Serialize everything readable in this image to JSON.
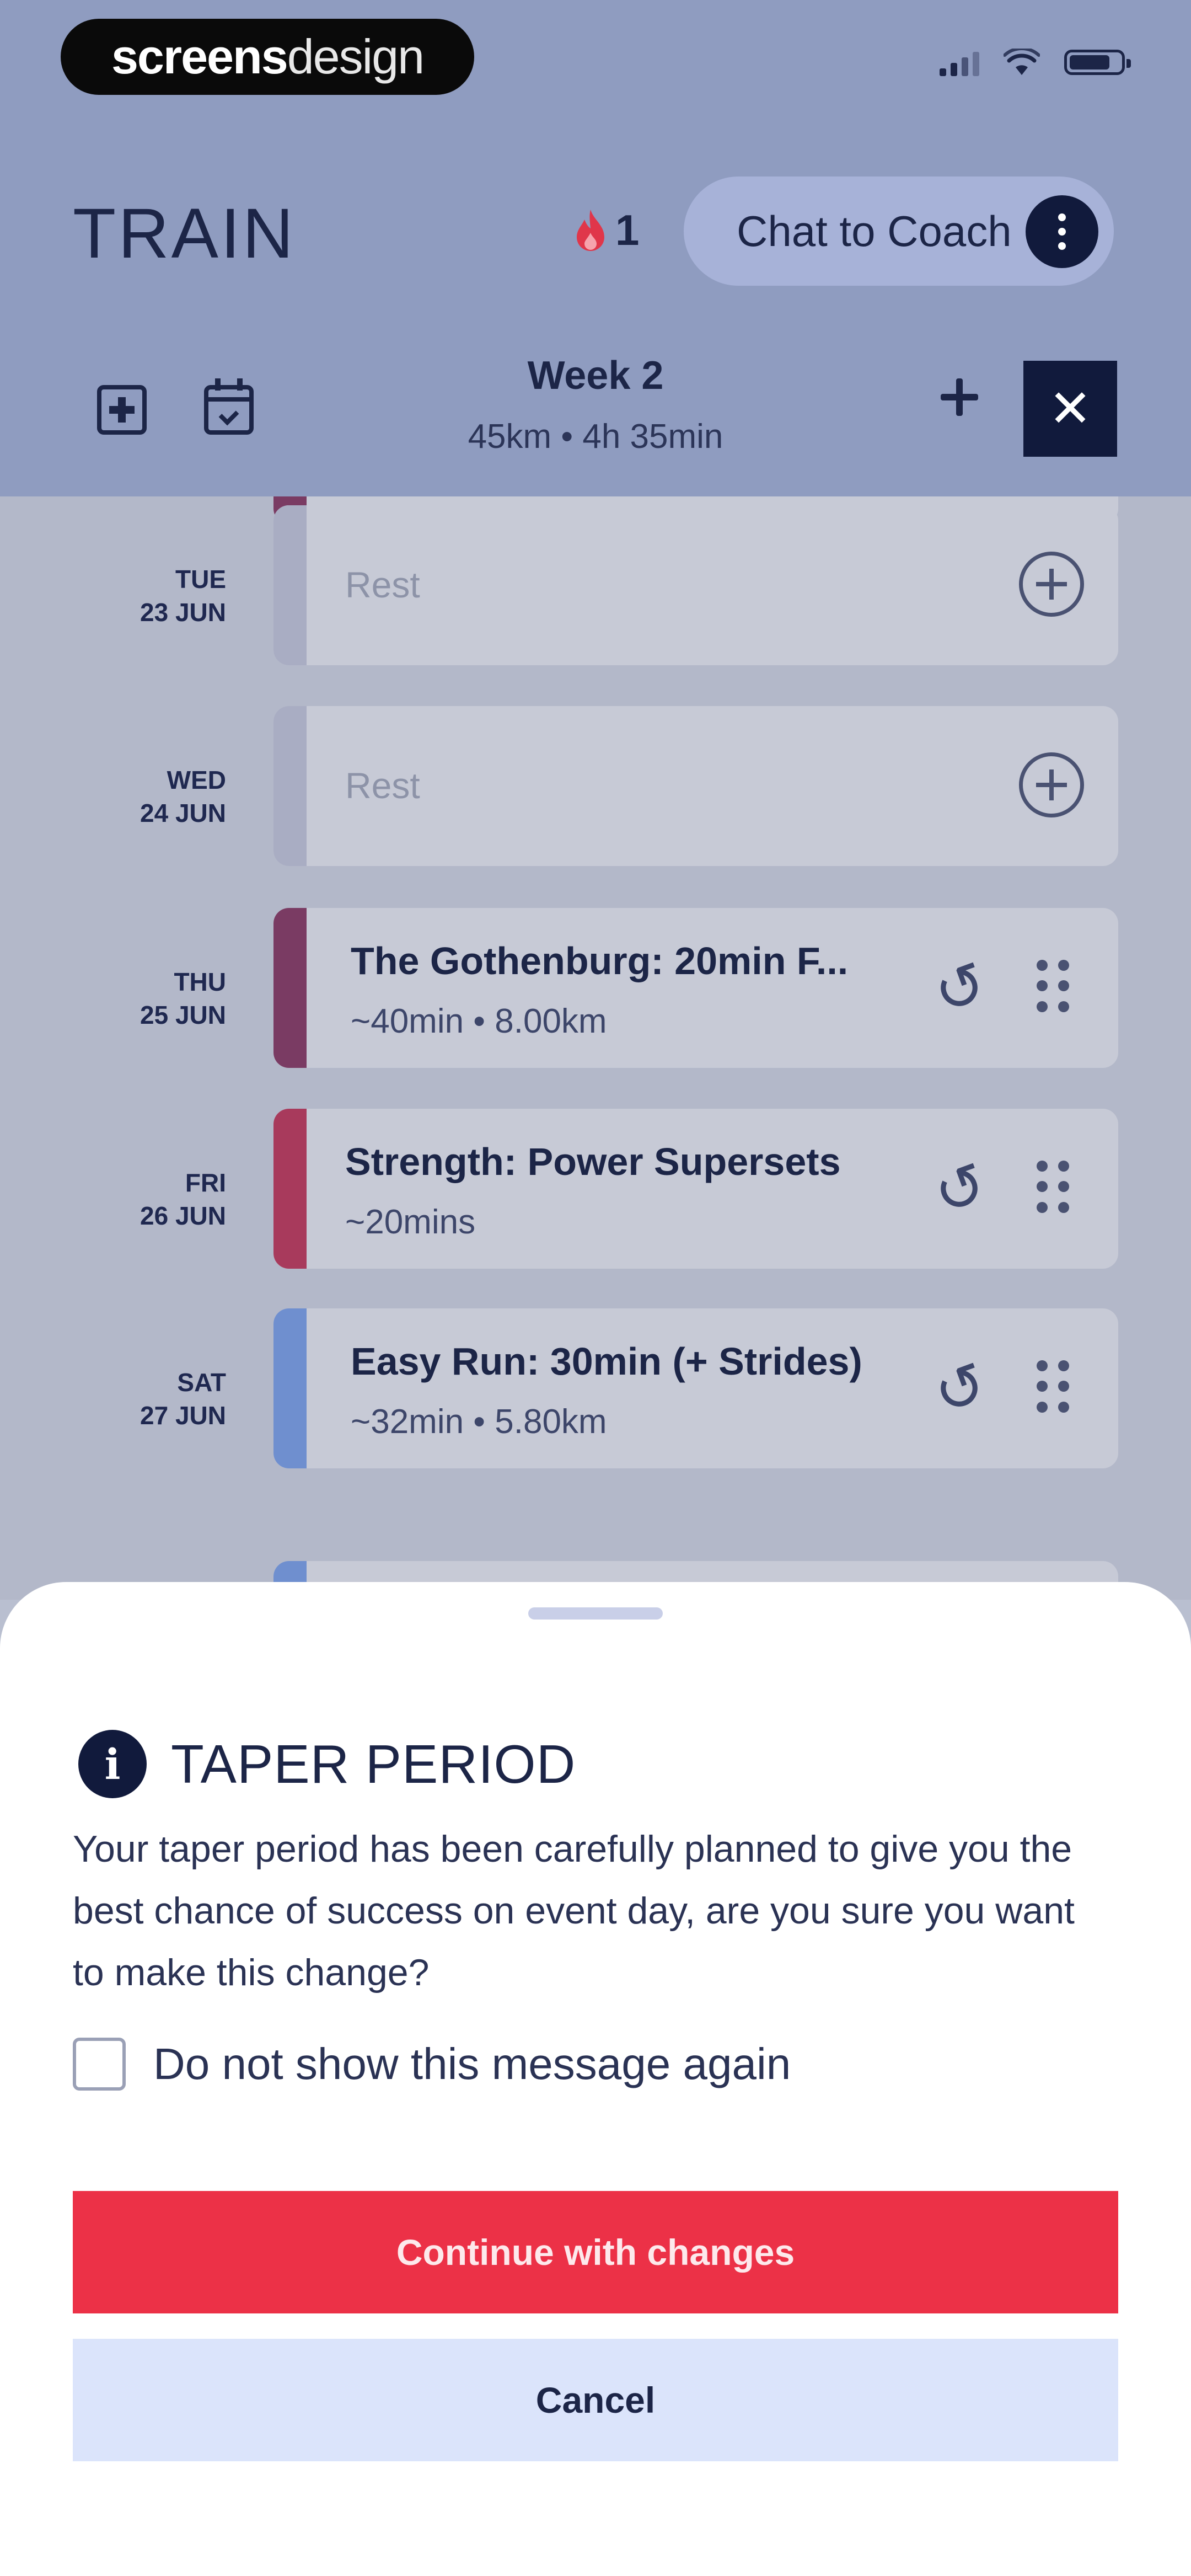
{
  "brand": {
    "part1": "screens",
    "part2": "design"
  },
  "header": {
    "title": "TRAIN",
    "streak_count": "1",
    "coach_button_label": "Chat to Coach"
  },
  "week": {
    "title": "Week 2",
    "summary": "45km • 4h 35min"
  },
  "days": [
    {
      "dow": "TUE",
      "date": "23 JUN",
      "type": "rest",
      "label": "Rest",
      "accent": "#a9adc3"
    },
    {
      "dow": "WED",
      "date": "24 JUN",
      "type": "rest",
      "label": "Rest",
      "accent": "#a9adc3"
    },
    {
      "dow": "THU",
      "date": "25 JUN",
      "type": "workout",
      "name": "The Gothenburg: 20min F...",
      "duration": "~40min",
      "distance": "8.00km",
      "accent": "#7a3b63"
    },
    {
      "dow": "FRI",
      "date": "26 JUN",
      "type": "workout",
      "name": "Strength: Power Supersets",
      "duration": "~20mins",
      "distance": "",
      "accent": "#a83a5c"
    },
    {
      "dow": "SAT",
      "date": "27 JUN",
      "type": "workout",
      "name": "Easy Run: 30min (+ Strides)",
      "duration": "~32min",
      "distance": "5.80km",
      "accent": "#6f8fcf"
    }
  ],
  "sheet": {
    "title": "TAPER PERIOD",
    "body": "Your taper period has been carefully planned to give you the best chance of success on event day, are you sure you want to make this change?",
    "checkbox_label": "Do not show this message again",
    "primary_label": "Continue with changes",
    "secondary_label": "Cancel"
  },
  "colors": {
    "primary": "#ec3147",
    "navy": "#111a3c",
    "secondary_bg": "#dbe4fb"
  }
}
